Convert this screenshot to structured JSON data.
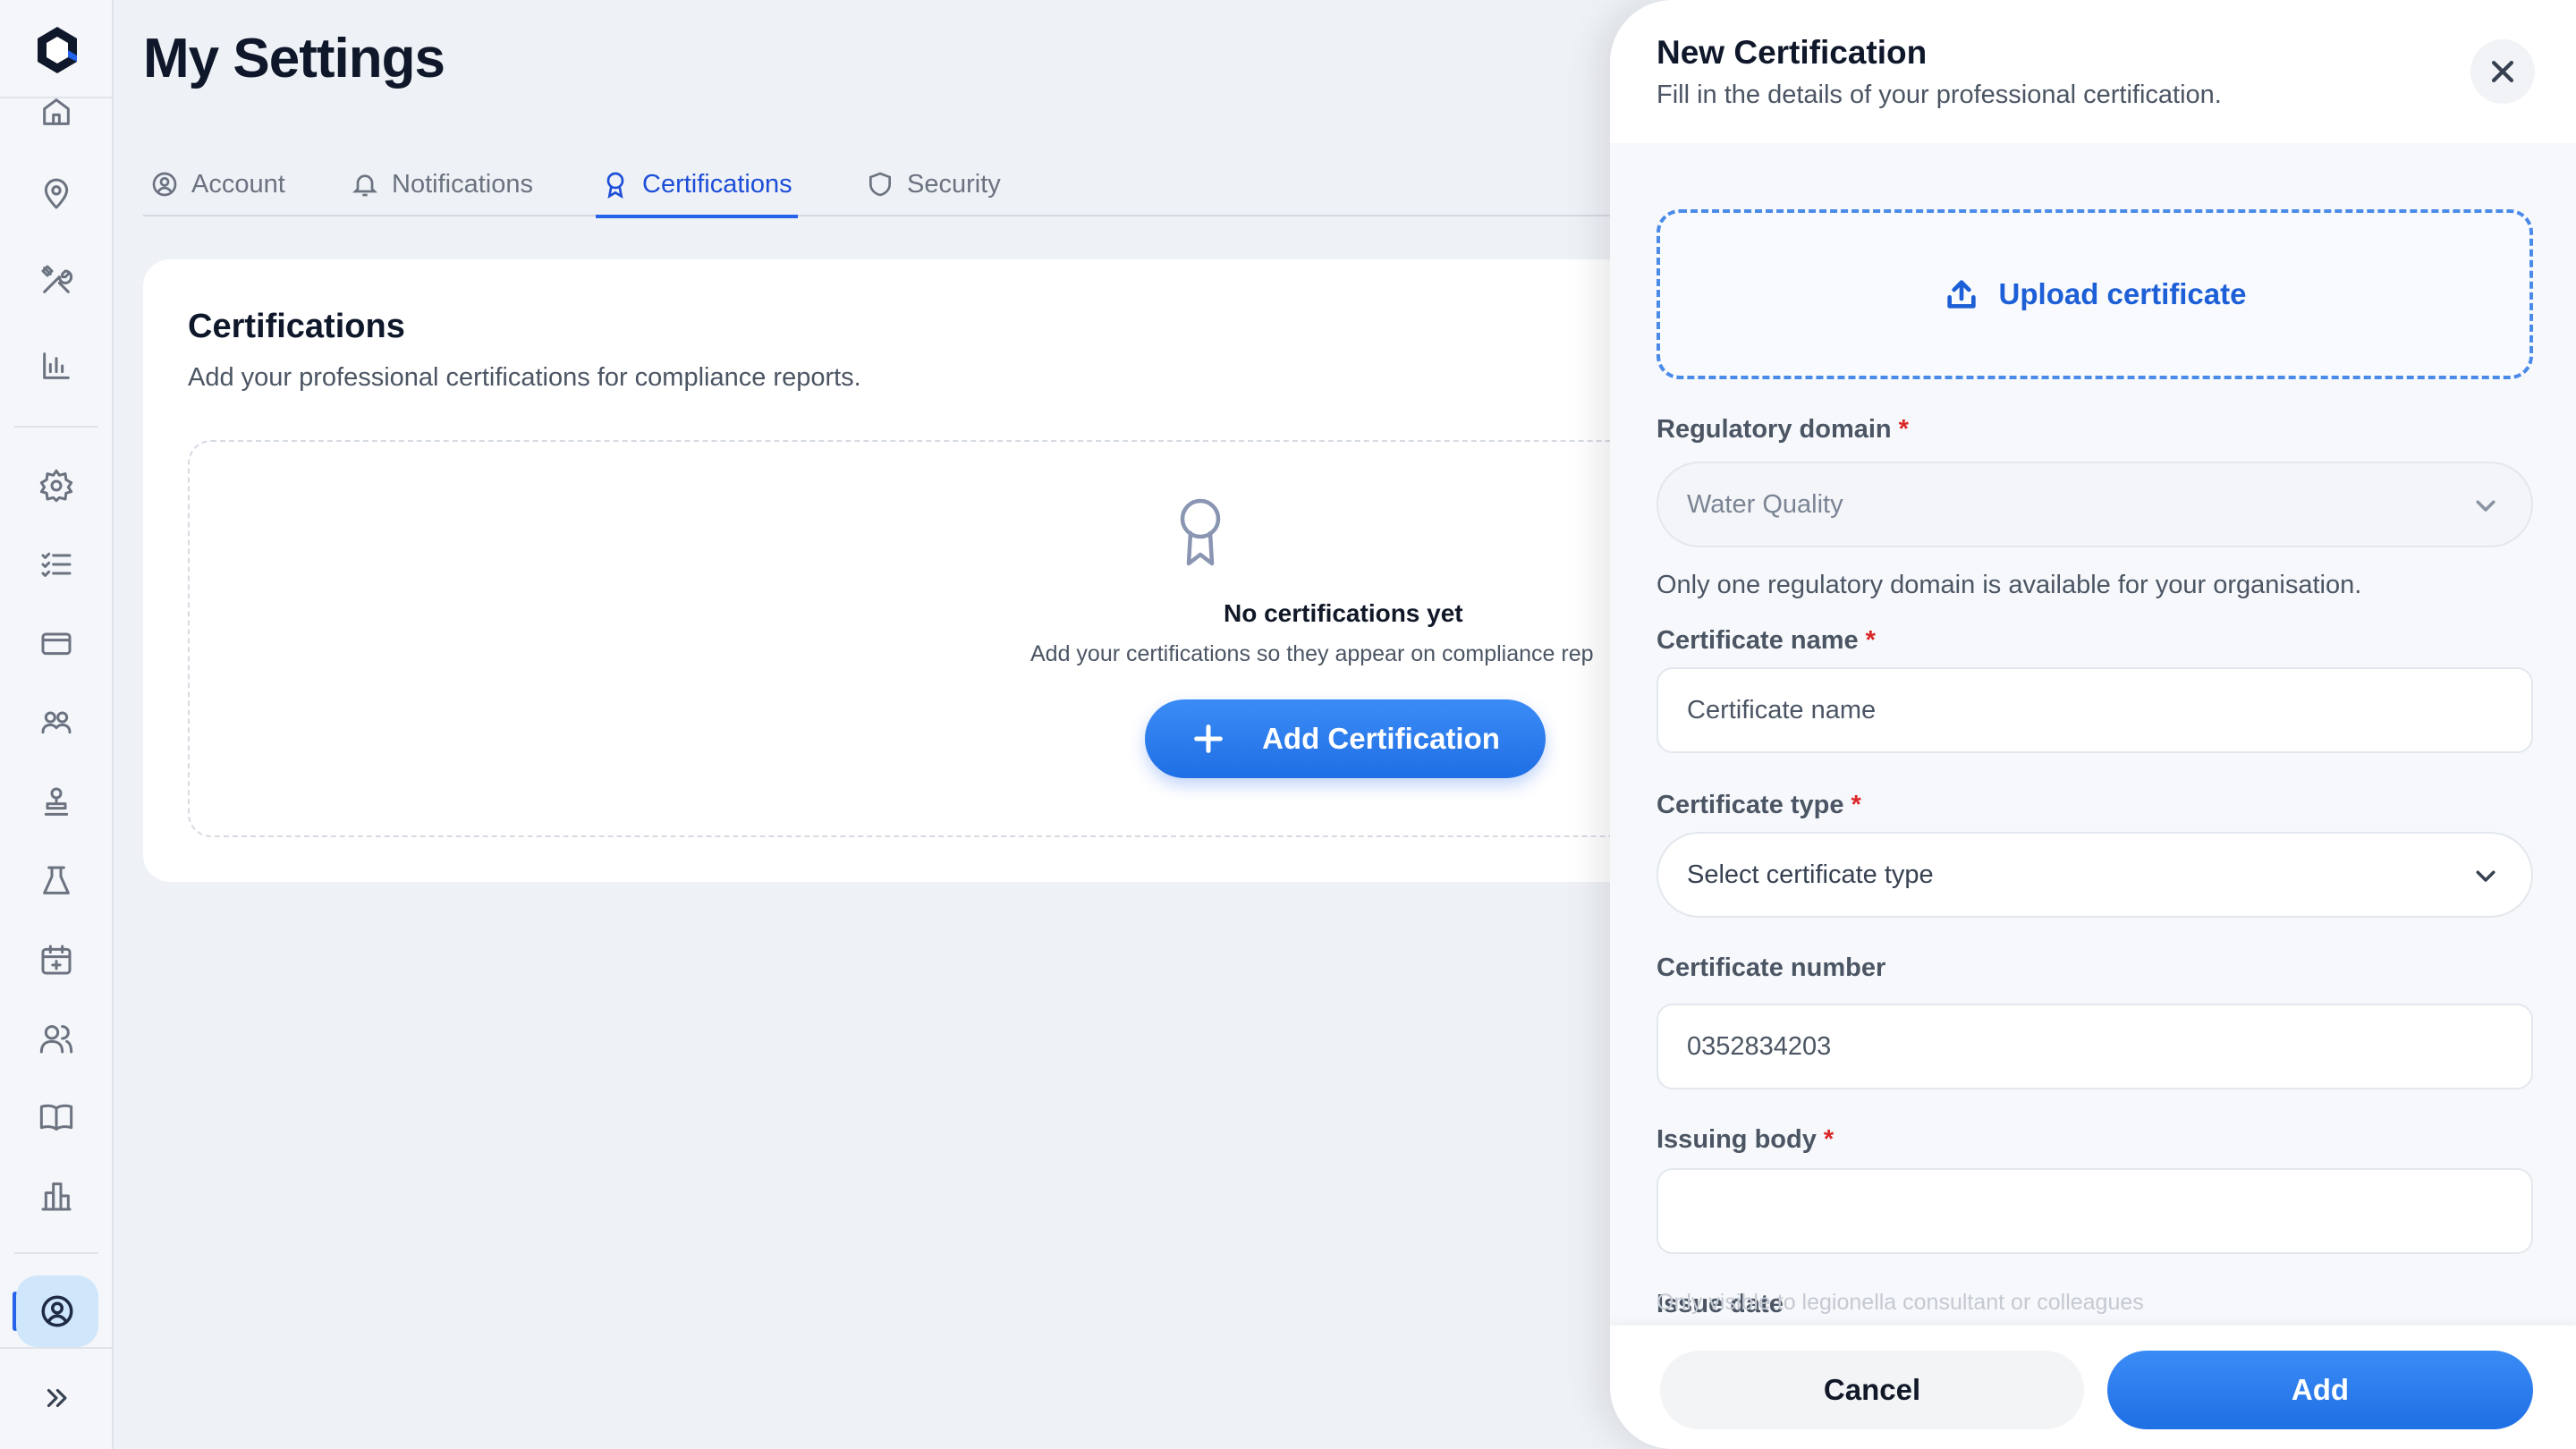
{
  "page": {
    "title": "My Settings"
  },
  "tabs": [
    {
      "label": "Account",
      "icon": "user-circle-icon",
      "active": false
    },
    {
      "label": "Notifications",
      "icon": "bell-icon",
      "active": false
    },
    {
      "label": "Certifications",
      "icon": "award-icon",
      "active": true
    },
    {
      "label": "Security",
      "icon": "shield-icon",
      "active": false
    }
  ],
  "card": {
    "title": "Certifications",
    "subtitle": "Add your professional certifications for compliance reports.",
    "empty_title": "No certifications yet",
    "empty_subtitle": "Add your certifications so they appear on compliance rep",
    "add_button": "Add Certification"
  },
  "sidebar": {
    "icons": [
      "home-icon",
      "map-pin-icon",
      "tools-icon",
      "bar-chart-icon",
      "gear-icon",
      "checklist-icon",
      "credit-card-icon",
      "groups-icon",
      "stamp-icon",
      "flask-icon",
      "calendar-add-icon",
      "users-icon",
      "book-icon",
      "buildings-icon"
    ],
    "active": "profile-icon",
    "expand": "chevrons-right-icon"
  },
  "drawer": {
    "title": "New Certification",
    "subtitle": "Fill in the details of your professional certification.",
    "upload_label": "Upload certificate",
    "regulatory_domain": {
      "label": "Regulatory domain",
      "value": "Water Quality",
      "help": "Only one regulatory domain is available for your organisation."
    },
    "certificate_name": {
      "label": "Certificate name",
      "placeholder": "Certificate name"
    },
    "certificate_type": {
      "label": "Certificate type",
      "placeholder": "Select certificate type"
    },
    "certificate_number": {
      "label": "Certificate number",
      "value": "0352834203"
    },
    "issuing_body": {
      "label": "Issuing body",
      "value": ""
    },
    "issue_date": {
      "label": "Issue date"
    },
    "faded_help": "Only visible to legionella consultant or colleagues",
    "required_mark": "*",
    "cancel_label": "Cancel",
    "submit_label": "Add"
  },
  "colors": {
    "accent": "#2563eb",
    "required": "#dc2626",
    "active_nav": "#cfe6fb"
  }
}
